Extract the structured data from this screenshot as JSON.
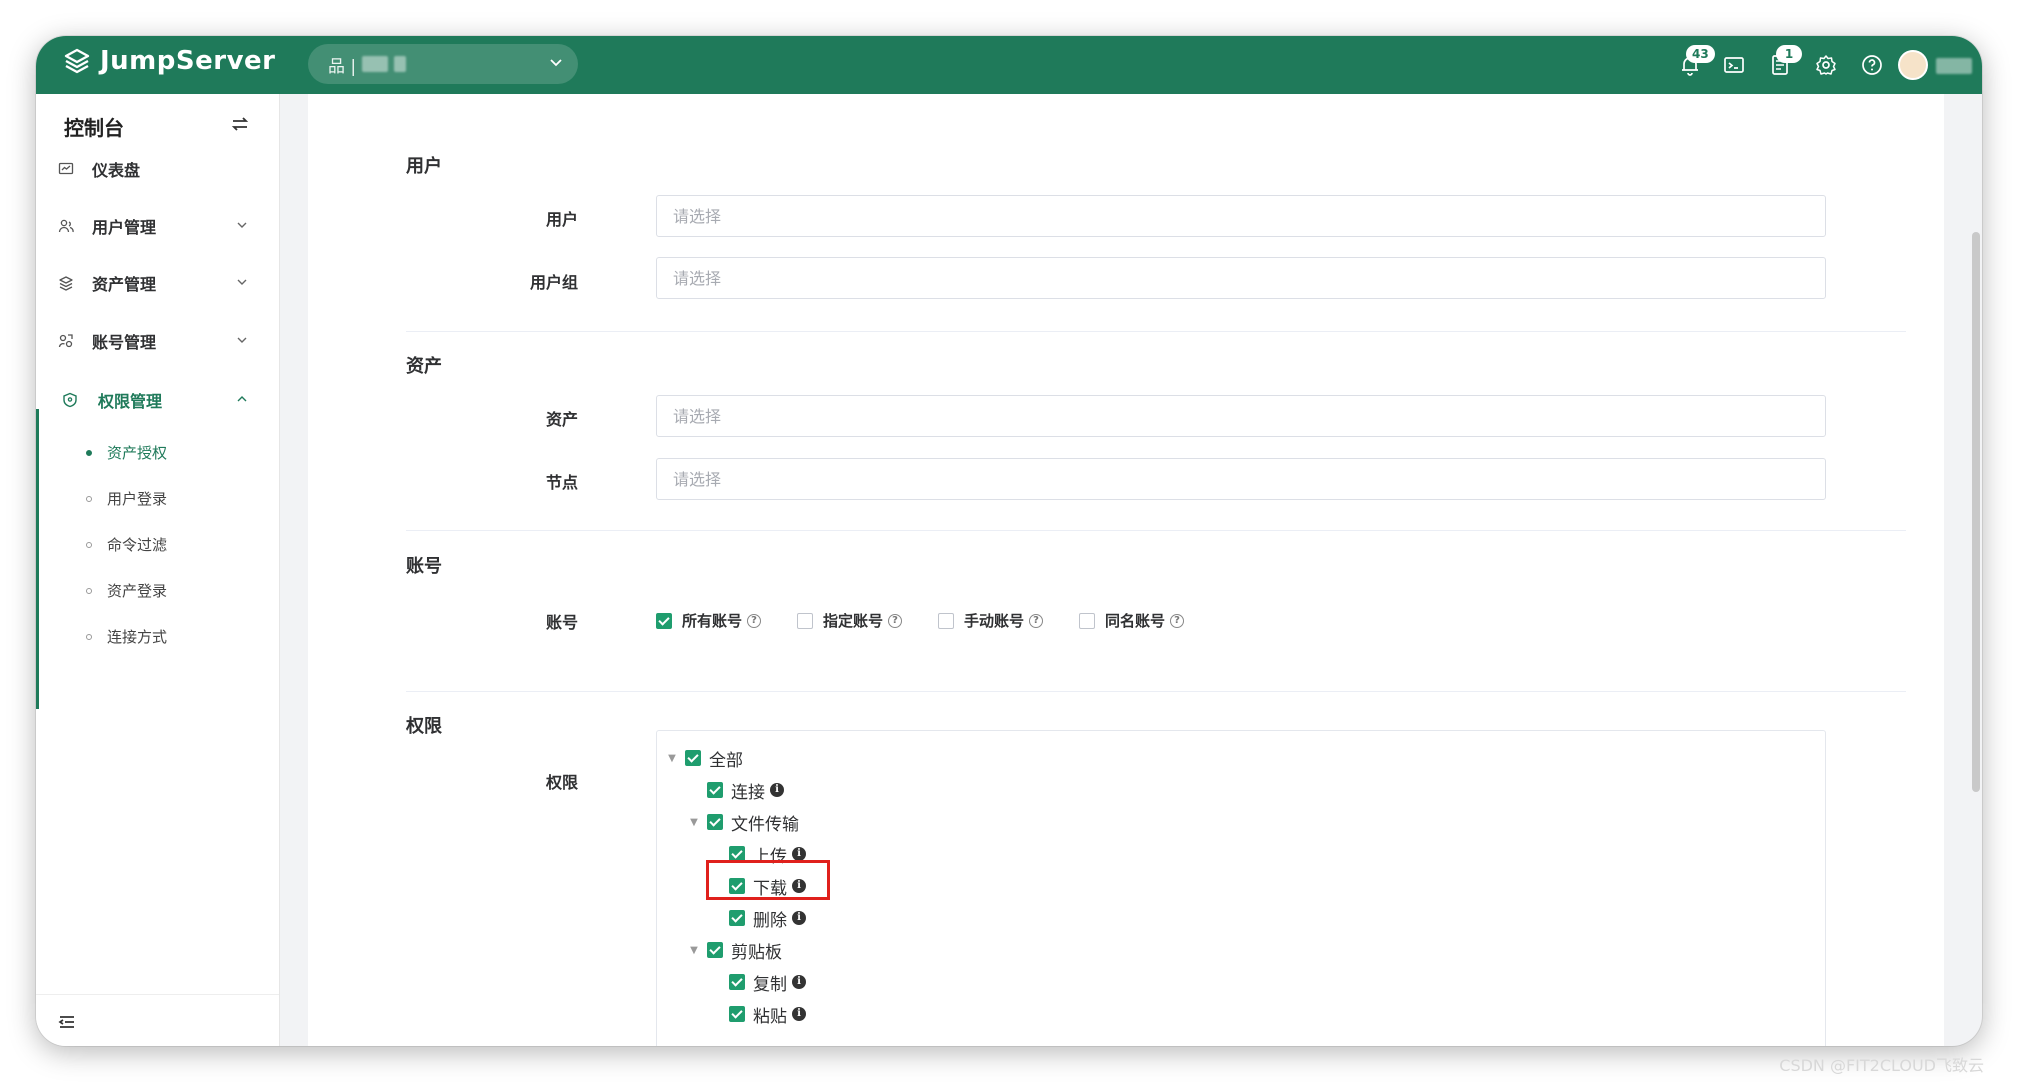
{
  "app": {
    "brand": "JumpServer",
    "org_prefix": "品 |",
    "colors": {
      "primary": "#1f7a5a",
      "check": "#1f9d6e",
      "highlight": "#e0201c"
    }
  },
  "header": {
    "notifications_badge": "43",
    "tickets_badge": "1",
    "icons": [
      "bell-icon",
      "terminal-icon",
      "ticket-icon",
      "settings-icon",
      "help-icon",
      "avatar"
    ]
  },
  "sidebar": {
    "title": "控制台",
    "items": [
      {
        "label": "仪表盘",
        "icon": "dashboard-icon"
      },
      {
        "label": "用户管理",
        "icon": "users-icon"
      },
      {
        "label": "资产管理",
        "icon": "assets-icon"
      },
      {
        "label": "账号管理",
        "icon": "accounts-icon"
      },
      {
        "label": "权限管理",
        "icon": "shield-icon"
      }
    ],
    "sub_items": [
      {
        "label": "资产授权"
      },
      {
        "label": "用户登录"
      },
      {
        "label": "命令过滤"
      },
      {
        "label": "资产登录"
      },
      {
        "label": "连接方式"
      }
    ]
  },
  "form": {
    "user_section": "用户",
    "user_label": "用户",
    "user_group_label": "用户组",
    "asset_section": "资产",
    "asset_label": "资产",
    "node_label": "节点",
    "account_section": "账号",
    "account_label": "账号",
    "account_options": [
      {
        "label": "所有账号",
        "checked": true
      },
      {
        "label": "指定账号",
        "checked": false
      },
      {
        "label": "手动账号",
        "checked": false
      },
      {
        "label": "同名账号",
        "checked": false
      }
    ],
    "perm_section": "权限",
    "perm_label": "权限",
    "placeholder": "请选择",
    "tree": [
      {
        "label": "全部",
        "checked": true,
        "caret": true
      },
      {
        "label": "连接",
        "checked": true,
        "info": true
      },
      {
        "label": "文件传输",
        "checked": true,
        "caret": true
      },
      {
        "label": "上传",
        "checked": true,
        "info": true
      },
      {
        "label": "下载",
        "checked": true,
        "info": true
      },
      {
        "label": "删除",
        "checked": true,
        "info": true
      },
      {
        "label": "剪贴板",
        "checked": true,
        "caret": true
      },
      {
        "label": "复制",
        "checked": true,
        "info": true
      },
      {
        "label": "粘贴",
        "checked": true,
        "info": true
      }
    ]
  },
  "watermark": "CSDN @FIT2CLOUD飞致云"
}
